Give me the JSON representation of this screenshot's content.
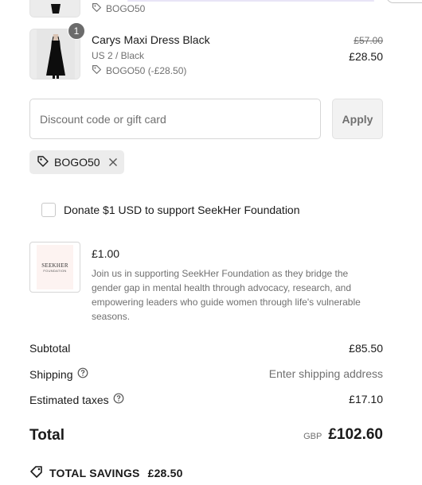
{
  "items": [
    {
      "discount_label": "BOGO50"
    },
    {
      "quantity": "1",
      "name": "Carys Maxi Dress Black",
      "variant": "US 2 / Black",
      "discount_label": "BOGO50 (-£28.50)",
      "price_original": "£57.00",
      "price_final": "£28.50"
    }
  ],
  "discount": {
    "placeholder": "Discount code or gift card",
    "apply_label": "Apply",
    "applied_code": "BOGO50"
  },
  "donation": {
    "checkbox_label": "Donate $1 USD to support SeekHer Foundation",
    "amount": "£1.00",
    "description": "Join us in supporting SeekHer Foundation as they bridge the gender gap in mental health through advocacy, research, and empowering leaders who guide women through life's vulnerable seasons.",
    "logo_text_1": "SEEKHER",
    "logo_text_2": "FOUNDATION"
  },
  "summary": {
    "subtotal_label": "Subtotal",
    "subtotal_value": "£85.50",
    "shipping_label": "Shipping",
    "shipping_value": "Enter shipping address",
    "taxes_label": "Estimated taxes",
    "taxes_value": "£17.10",
    "total_label": "Total",
    "currency": "GBP",
    "total_value": "£102.60",
    "savings_label": "TOTAL SAVINGS",
    "savings_value": "£28.50"
  },
  "colors": {
    "text": "#1a1a1a",
    "muted": "#707070",
    "chip_bg": "#ececec",
    "badge_bg": "#6b6b6b",
    "border": "#d6d6d6"
  }
}
